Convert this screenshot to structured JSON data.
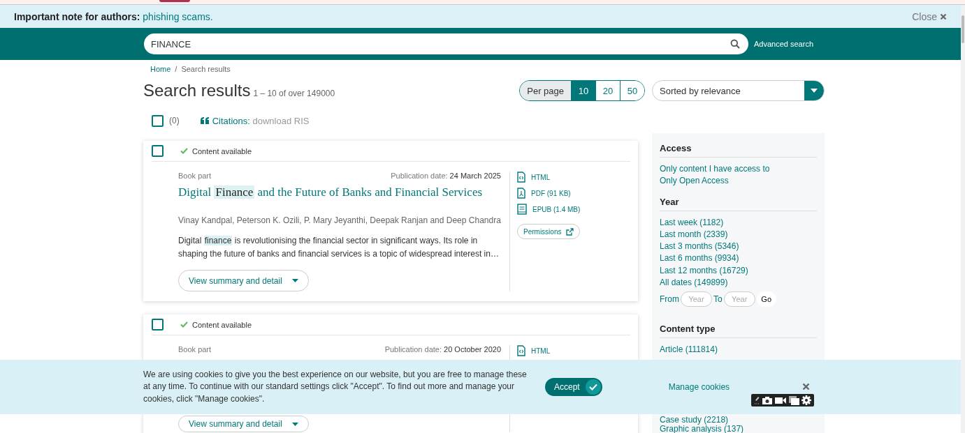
{
  "notice": {
    "label": "Important note for authors:",
    "link": "phishing scams.",
    "close": "Close"
  },
  "search": {
    "value": "FINANCE",
    "advanced": "Advanced search"
  },
  "breadcrumb": {
    "home": "Home",
    "separator": "/",
    "current": "Search results"
  },
  "heading": {
    "title": "Search results",
    "range": "1 – 10 of over 149000"
  },
  "per_page": {
    "label": "Per page",
    "options": [
      {
        "label": "10",
        "selected": true
      },
      {
        "label": "20",
        "selected": false
      },
      {
        "label": "50",
        "selected": false
      }
    ]
  },
  "sort": {
    "value": "Sorted by relevance"
  },
  "select_all": {
    "checked": false,
    "count": "(0)"
  },
  "citations": {
    "label": "Citations:",
    "action": "download RIS"
  },
  "results": [
    {
      "checked": false,
      "availability": "Content available",
      "type": "Book part",
      "date_label": "Publication date:",
      "date": "24 March 2025",
      "title": [
        {
          "text": "Digital ",
          "highlight": false
        },
        {
          "text": "Finance",
          "highlight": true
        },
        {
          "text": " and the Future of Banks and Financial Services",
          "highlight": false
        }
      ],
      "authors": "Vinay Kandpal, Peterson K. Ozili, P. Mary Jeyanthi, Deepak Ranjan and Deep Chandra",
      "abstract": [
        {
          "text": "Digital ",
          "highlight": false
        },
        {
          "text": "finance",
          "highlight": true
        },
        {
          "text": " is revolutionising the financial sector in significant ways. Its role in shaping the future of banks and financial services is a topic of widespread interest in…",
          "highlight": false
        }
      ],
      "formats": [
        {
          "kind": "html",
          "label": "HTML"
        },
        {
          "kind": "pdf",
          "label": "PDF (91 KB)"
        },
        {
          "kind": "epub",
          "label": "EPUB (1.4 MB)"
        }
      ],
      "permissions": "Permissions",
      "summary_button": "View summary and detail"
    },
    {
      "checked": false,
      "availability": "Content available",
      "type": "Book part",
      "date_label": "Publication date:",
      "date": "20 October 2020",
      "formats": [
        {
          "kind": "html",
          "label": "HTML"
        }
      ],
      "summary_button": "View summary and detail"
    }
  ],
  "filters": [
    {
      "title": "Access",
      "items": [
        "Only content I have access to",
        "Only Open Access"
      ]
    },
    {
      "title": "Year",
      "items": [
        "Last week (1182)",
        "Last month (2339)",
        "Last 3 months (5346)",
        "Last 6 months (9934)",
        "Last 12 months (16729)",
        "All dates (149899)"
      ],
      "range": {
        "from": "From",
        "from_placeholder": "Year",
        "to": "To",
        "to_placeholder": "Year",
        "go": "Go"
      }
    },
    {
      "title": "Content type",
      "items": [
        "Article (111814)"
      ],
      "more_items": [
        "Case study (2218)",
        "Graphic analysis (137)"
      ]
    }
  ],
  "cookie": {
    "text": "We are using cookies to give you the best experience on our website, but you are free to manage these at any time. To continue with our standard settings click \"Accept\". To find out more and manage your cookies, click \"Manage cookies\".",
    "accept": "Accept",
    "manage": "Manage cookies"
  }
}
